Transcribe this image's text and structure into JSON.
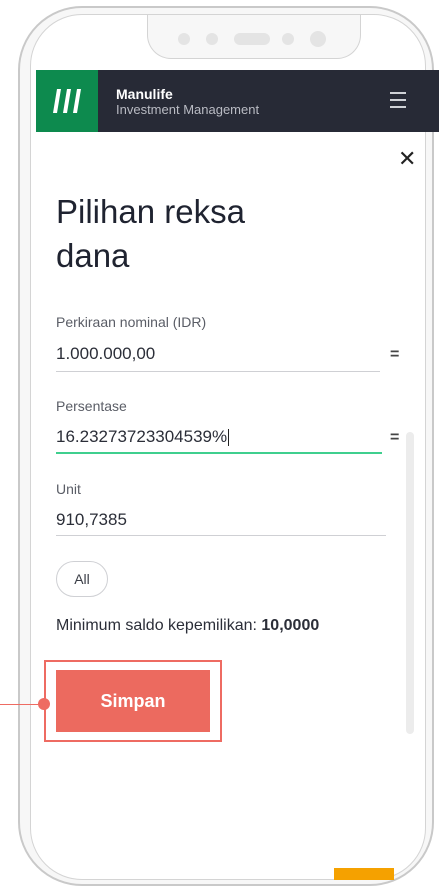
{
  "header": {
    "brand_name": "Manulife",
    "brand_sub": "Investment Management"
  },
  "dialog": {
    "title": "Pilihan reksa dana"
  },
  "fields": {
    "nominal": {
      "label": "Perkiraan nominal (IDR)",
      "value": "1.000.000,00",
      "symbol": "="
    },
    "persentase": {
      "label": "Persentase",
      "value": "16.23273723304539%",
      "symbol": "="
    },
    "unit": {
      "label": "Unit",
      "value": "910,7385"
    }
  },
  "all_button": "All",
  "min_saldo": {
    "label": "Minimum saldo kepemilikan: ",
    "value": "10,0000"
  },
  "save_button": "Simpan",
  "colors": {
    "brand_green": "#0d8a4e",
    "header_bg": "#272a36",
    "save_red": "#ec6a5f",
    "active_line": "#3fcf8e",
    "highlight": "#ee6b62",
    "orange": "#f5a100"
  },
  "icons": {
    "close": "close-icon",
    "menu": "hamburger-menu-icon",
    "logo": "manulife-logo-icon"
  }
}
